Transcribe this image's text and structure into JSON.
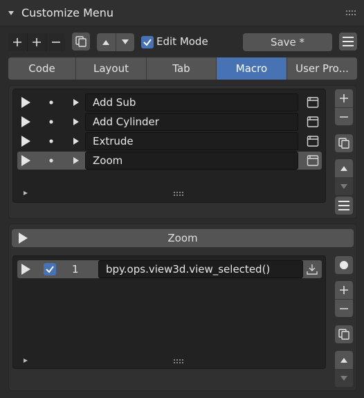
{
  "header": {
    "title": "Customize Menu"
  },
  "toolbar": {
    "edit_mode_label": "Edit Mode",
    "edit_mode_checked": true,
    "save_label": "Save *"
  },
  "tabs": [
    {
      "label": "Code",
      "active": false
    },
    {
      "label": "Layout",
      "active": false
    },
    {
      "label": "Tab",
      "active": false
    },
    {
      "label": "Macro",
      "active": true
    },
    {
      "label": "User Pro...",
      "active": false
    }
  ],
  "macros": [
    {
      "name": "Add Sub",
      "selected": false
    },
    {
      "name": "Add Cylinder",
      "selected": false
    },
    {
      "name": "Extrude",
      "selected": false
    },
    {
      "name": "Zoom",
      "selected": true
    }
  ],
  "selected_macro": {
    "name": "Zoom"
  },
  "commands": [
    {
      "index": "1",
      "enabled": true,
      "command": "bpy.ops.view3d.view_selected()"
    }
  ],
  "colors": {
    "accent": "#4772b3",
    "panel": "#303030",
    "list": "#222222",
    "button": "#545454"
  }
}
